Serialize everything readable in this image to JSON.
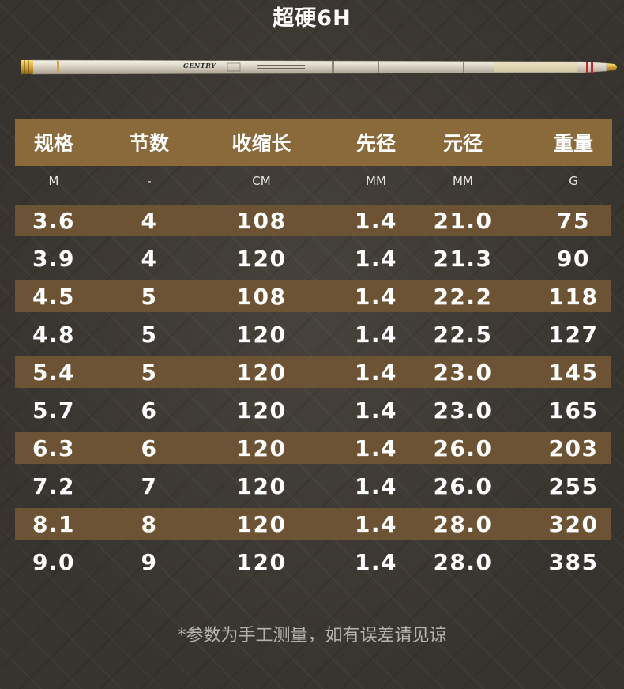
{
  "title": "超硬6H",
  "rod": {
    "brand": "GENTRY"
  },
  "table": {
    "headers": [
      "规格",
      "节数",
      "收缩长",
      "先径",
      "元径",
      "重量"
    ],
    "units": [
      "M",
      "-",
      "CM",
      "MM",
      "MM",
      "G"
    ],
    "rows": [
      [
        "3.6",
        "4",
        "108",
        "1.4",
        "21.0",
        "75"
      ],
      [
        "3.9",
        "4",
        "120",
        "1.4",
        "21.3",
        "90"
      ],
      [
        "4.5",
        "5",
        "108",
        "1.4",
        "22.2",
        "118"
      ],
      [
        "4.8",
        "5",
        "120",
        "1.4",
        "22.5",
        "127"
      ],
      [
        "5.4",
        "5",
        "120",
        "1.4",
        "23.0",
        "145"
      ],
      [
        "5.7",
        "6",
        "120",
        "1.4",
        "23.0",
        "165"
      ],
      [
        "6.3",
        "6",
        "120",
        "1.4",
        "26.0",
        "203"
      ],
      [
        "7.2",
        "7",
        "120",
        "1.4",
        "26.0",
        "255"
      ],
      [
        "8.1",
        "8",
        "120",
        "1.4",
        "28.0",
        "320"
      ],
      [
        "9.0",
        "9",
        "120",
        "1.4",
        "28.0",
        "385"
      ]
    ]
  },
  "footnote": "*参数为手工测量，如有误差请见谅",
  "colors": {
    "background": "#3c3833",
    "header_band": "#8a6a3b",
    "row_band": "#6c5333",
    "rod_gold": "#d4a63a"
  }
}
